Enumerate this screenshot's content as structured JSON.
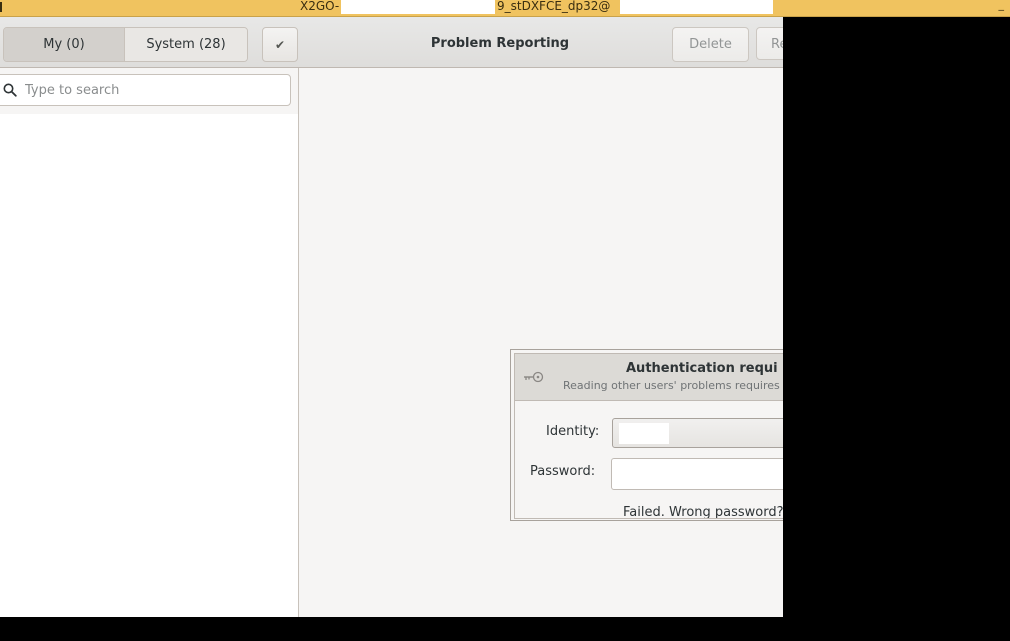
{
  "x2go_bar": {
    "title_prefix": "X2GO-",
    "title_middle": "9_stDXFCE_dp32@",
    "close_glyph": "_"
  },
  "header": {
    "tabs": [
      {
        "label": "My (0)",
        "active": true
      },
      {
        "label": "System (28)",
        "active": false
      }
    ],
    "select_icon": "checkmark-icon",
    "select_glyph": "✔",
    "title": "Problem Reporting",
    "delete_label": "Delete",
    "report_label": "Re"
  },
  "sidebar": {
    "search": {
      "placeholder": "Type to search",
      "value": "",
      "icon": "search-icon"
    }
  },
  "auth_dialog": {
    "icon": "key-icon",
    "title": "Authentication requi",
    "subtitle": "Reading other users' problems requires",
    "identity_label": "Identity:",
    "password_label": "Password:",
    "password_value": "",
    "error_message": "Failed. Wrong password?"
  },
  "colors": {
    "x2go_bar": "#f0c35f",
    "window_bg": "#f6f5f4",
    "outside_bg": "#000000"
  }
}
